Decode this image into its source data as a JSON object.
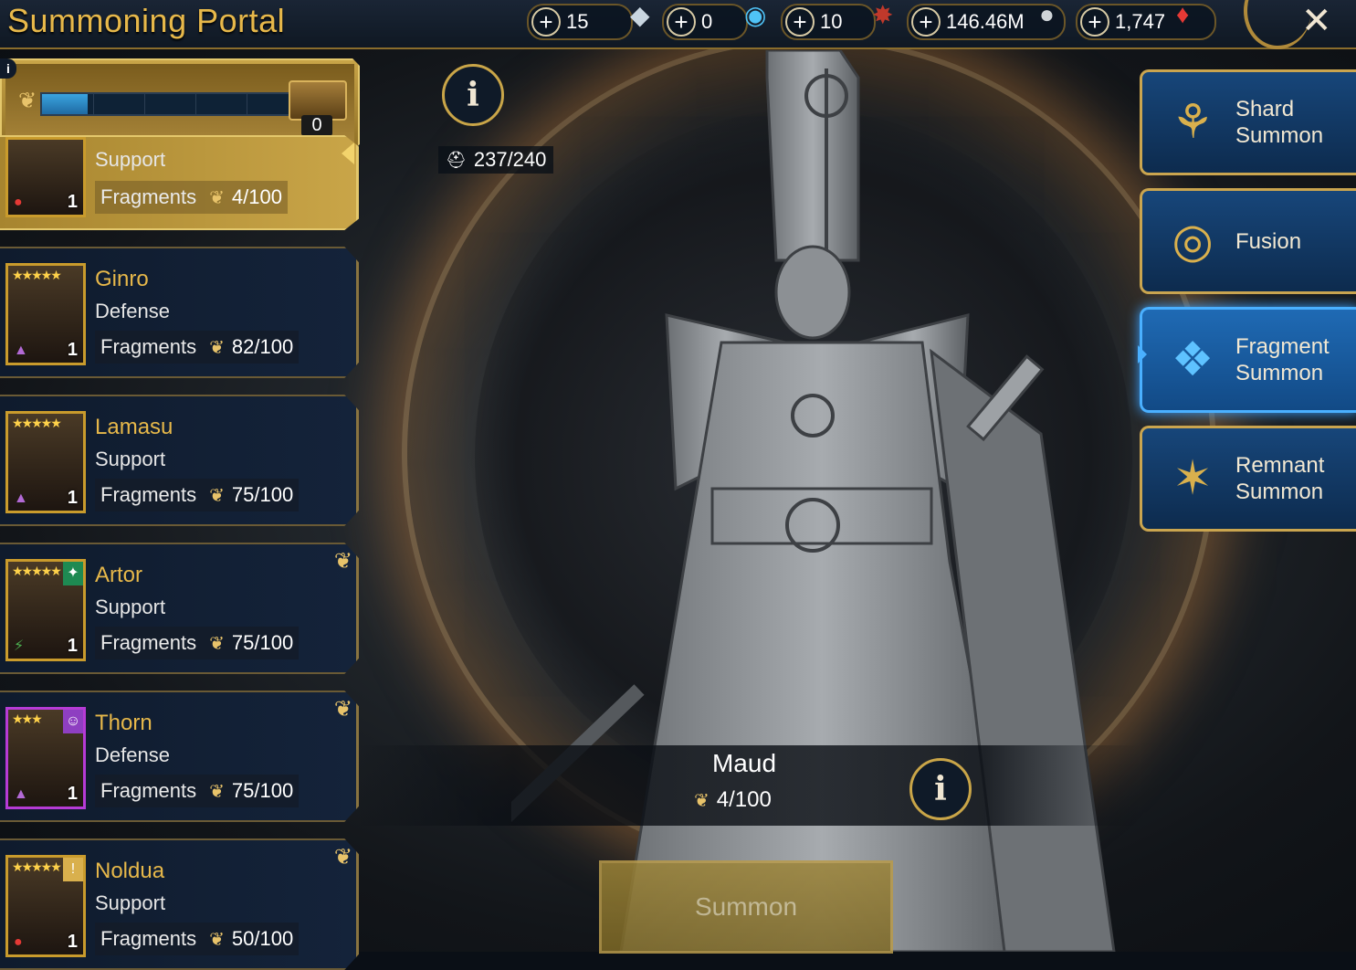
{
  "header": {
    "title": "Summoning Portal",
    "resources": [
      {
        "name": "energy",
        "value": "15",
        "icon": "crystal-icon"
      },
      {
        "name": "ancient_shards",
        "value": "0",
        "icon": "ancient-shard-icon"
      },
      {
        "name": "arena_tokens",
        "value": "10",
        "icon": "arena-token-icon"
      },
      {
        "name": "silver",
        "value": "146.46M",
        "icon": "silver-coin-icon"
      },
      {
        "name": "gems",
        "value": "1,747",
        "icon": "ruby-gem-icon"
      }
    ],
    "close_icon": "close-icon"
  },
  "progress": {
    "value": "0",
    "fill_fraction": 0.18
  },
  "champions": [
    {
      "name": "",
      "role": "Support",
      "frag_label": "Fragments",
      "fragments": "4/100",
      "level": "1",
      "selected": true
    },
    {
      "name": "Ginro",
      "role": "Defense",
      "frag_label": "Fragments",
      "fragments": "82/100",
      "level": "1"
    },
    {
      "name": "Lamasu",
      "role": "Support",
      "frag_label": "Fragments",
      "fragments": "75/100",
      "level": "1"
    },
    {
      "name": "Artor",
      "role": "Support",
      "frag_label": "Fragments",
      "fragments": "75/100",
      "level": "1"
    },
    {
      "name": "Thorn",
      "role": "Defense",
      "frag_label": "Fragments",
      "fragments": "75/100",
      "level": "1"
    },
    {
      "name": "Noldua",
      "role": "Support",
      "frag_label": "Fragments",
      "fragments": "50/100",
      "level": "1"
    }
  ],
  "center": {
    "capacity": "237/240",
    "champion_name": "Maud",
    "champion_fragments": "4/100",
    "summon_label": "Summon"
  },
  "menu": [
    {
      "label": "Shard Summon",
      "icon": "shard-summon-icon",
      "active": false
    },
    {
      "label": "Fusion",
      "icon": "fusion-icon",
      "active": false
    },
    {
      "label": "Fragment Summon",
      "icon": "fragment-summon-icon",
      "active": true
    },
    {
      "label": "Remnant Summon",
      "icon": "remnant-summon-icon",
      "active": false
    }
  ],
  "colors": {
    "accent_gold": "#e7b84a",
    "menu_blue": "#17467a",
    "active_blue": "#4ab0ff"
  }
}
